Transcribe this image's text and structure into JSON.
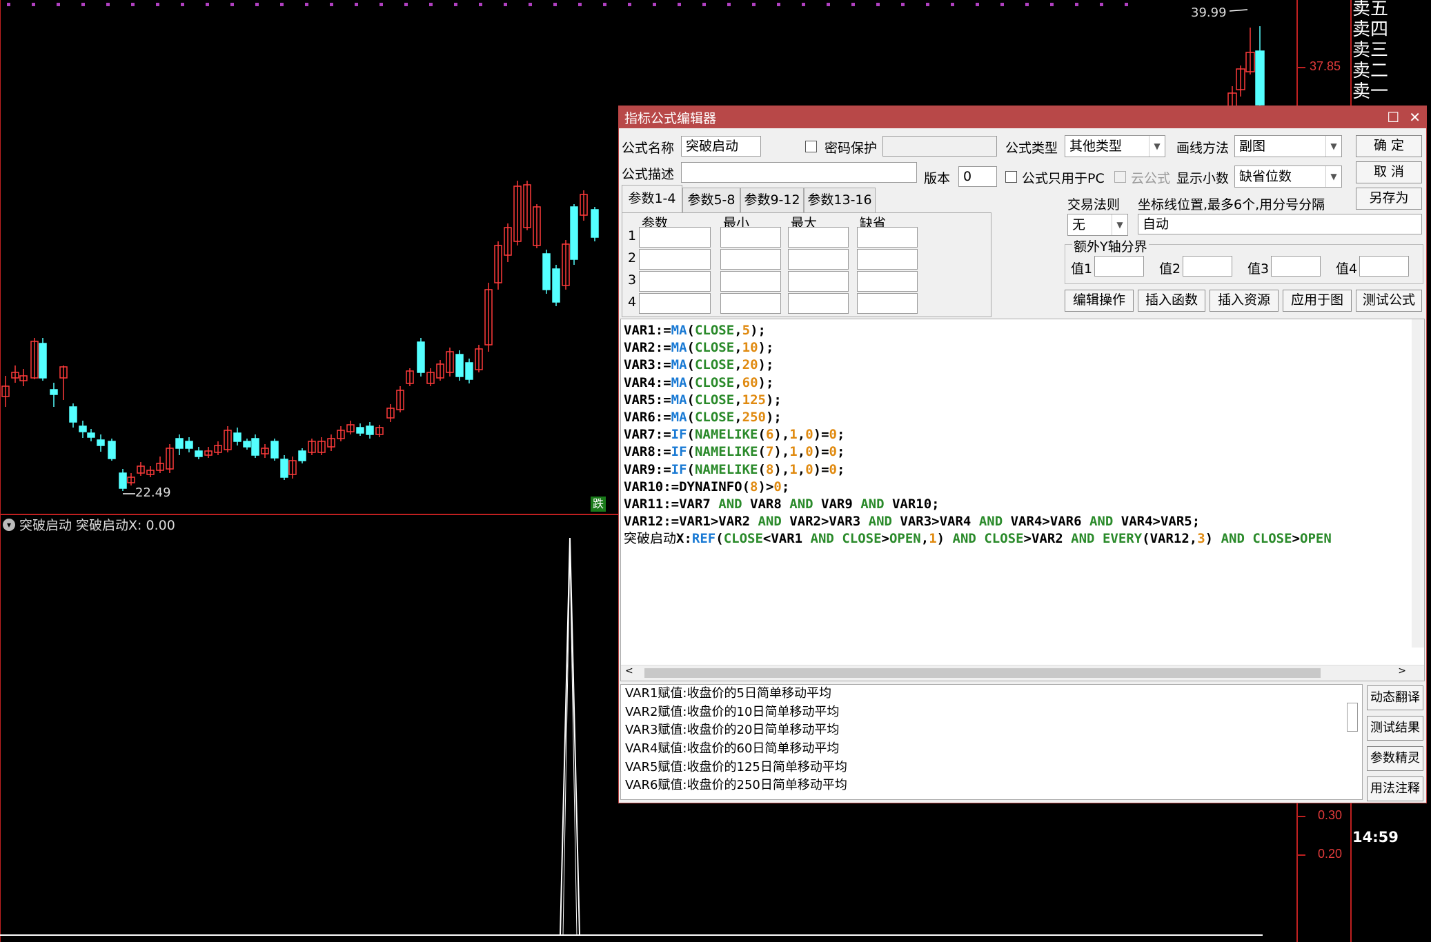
{
  "chart": {
    "price_axis": [
      "37.85"
    ],
    "indicator_axis": [
      "0.30",
      "0.20"
    ],
    "order_book": [
      "卖五",
      "卖四",
      "卖三",
      "卖二",
      "卖一"
    ],
    "high_label": "39.99",
    "low_label": "22.49",
    "fall_badge": "跌",
    "indicator_title": "突破启动  突破启动X: 0.00",
    "time": "14:59",
    "colors": {
      "up": "#ff3b3b",
      "down": "#54ffff",
      "axis": "#c02020",
      "signal": "#ffffff"
    }
  },
  "dialog": {
    "title": "指标公式编辑器",
    "name_label": "公式名称",
    "name_value": "突破启动",
    "password_label": "密码保护",
    "type_label": "公式类型",
    "type_value": "其他类型",
    "draw_label": "画线方法",
    "draw_value": "副图",
    "ok": "确  定",
    "cancel": "取  消",
    "save_as": "另存为",
    "desc_label": "公式描述",
    "version_label": "版本",
    "version_value": "0",
    "pc_only_label": "公式只用于PC",
    "cloud_label": "云公式",
    "decimal_label": "显示小数",
    "decimal_value": "缺省位数",
    "tabs": [
      "参数1-4",
      "参数5-8",
      "参数9-12",
      "参数13-16"
    ],
    "param_headers": [
      "参数",
      "最小",
      "最大",
      "缺省"
    ],
    "param_rows": [
      "1",
      "2",
      "3",
      "4"
    ],
    "trade_rule_label": "交易法则",
    "trade_rule_value": "无",
    "coord_label": "坐标线位置,最多6个,用分号分隔",
    "coord_value": "自动",
    "extra_y_label": "额外Y轴分界",
    "val_labels": [
      "值1",
      "值2",
      "值3",
      "值4"
    ],
    "actions": [
      "编辑操作",
      "插入函数",
      "插入资源",
      "应用于图",
      "测试公式"
    ],
    "output_lines": [
      "VAR1赋值:收盘价的5日简单移动平均",
      "VAR2赋值:收盘价的10日简单移动平均",
      "VAR3赋值:收盘价的20日简单移动平均",
      "VAR4赋值:收盘价的60日简单移动平均",
      "VAR5赋值:收盘价的125日简单移动平均",
      "VAR6赋值:收盘价的250日简单移动平均"
    ],
    "side_buttons": [
      "动态翻译",
      "测试结果",
      "参数精灵",
      "用法注释"
    ]
  }
}
